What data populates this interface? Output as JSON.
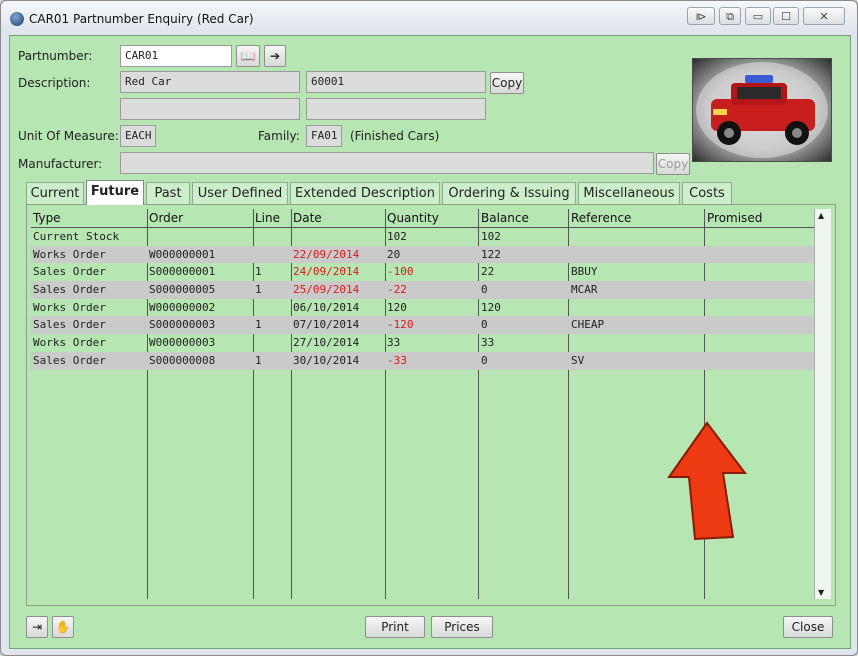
{
  "window": {
    "title": "CAR01 Partnumber Enquiry (Red Car)"
  },
  "form": {
    "partnumber_label": "Partnumber:",
    "partnumber_value": "CAR01",
    "description_label": "Description:",
    "description_value": "Red Car",
    "description_code": "60001",
    "description_line2": "",
    "description_line3": "",
    "copy_label": "Copy",
    "uom_label": "Unit Of Measure:",
    "uom_value": "EACH",
    "family_label": "Family:",
    "family_value": "FA01",
    "family_desc": "(Finished Cars)",
    "manufacturer_label": "Manufacturer:",
    "manufacturer_value": "",
    "manufacturer_copy_label": "Copy"
  },
  "tabs": [
    "Current",
    "Future",
    "Past",
    "User Defined",
    "Extended Description",
    "Ordering & Issuing",
    "Miscellaneous",
    "Costs"
  ],
  "active_tab": "Future",
  "grid": {
    "headers": [
      "Type",
      "Order",
      "Line",
      "Date",
      "Quantity",
      "Balance",
      "Reference",
      "Promised"
    ],
    "rows": [
      {
        "type": "Current Stock",
        "order": "",
        "line": "",
        "date": "",
        "qty": "102",
        "balance": "102",
        "ref": "",
        "promised": ""
      },
      {
        "type": "Works Order",
        "order": "W000000001",
        "line": "",
        "date": "22/09/2014",
        "qty": "20",
        "balance": "122",
        "ref": "",
        "promised": ""
      },
      {
        "type": "Sales Order",
        "order": "S000000001",
        "line": "1",
        "date": "24/09/2014",
        "qty": "-100",
        "balance": "22",
        "ref": "BBUY",
        "promised": ""
      },
      {
        "type": "Sales Order",
        "order": "S000000005",
        "line": "1",
        "date": "25/09/2014",
        "qty": "-22",
        "balance": "0",
        "ref": "MCAR",
        "promised": ""
      },
      {
        "type": "Works Order",
        "order": "W000000002",
        "line": "",
        "date": "06/10/2014",
        "qty": "120",
        "balance": "120",
        "ref": "",
        "promised": ""
      },
      {
        "type": "Sales Order",
        "order": "S000000003",
        "line": "1",
        "date": "07/10/2014",
        "qty": "-120",
        "balance": "0",
        "ref": "CHEAP",
        "promised": ""
      },
      {
        "type": "Works Order",
        "order": "W000000003",
        "line": "",
        "date": "27/10/2014",
        "qty": "33",
        "balance": "33",
        "ref": "",
        "promised": ""
      },
      {
        "type": "Sales Order",
        "order": "S000000008",
        "line": "1",
        "date": "30/10/2014",
        "qty": "-33",
        "balance": "0",
        "ref": "SV",
        "promised": ""
      }
    ]
  },
  "footer": {
    "print_label": "Print",
    "prices_label": "Prices",
    "close_label": "Close"
  },
  "colors": {
    "accent_red": "#dd1b1b",
    "background_green": "#b6e6b2"
  }
}
